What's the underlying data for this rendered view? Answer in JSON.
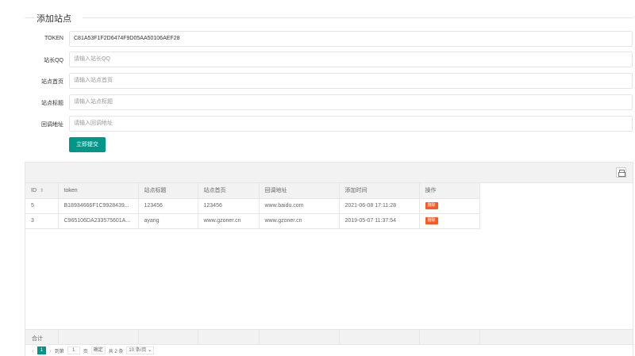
{
  "form": {
    "title": "添加站点",
    "fields": [
      {
        "label": "TOKEN",
        "value": "C81A53F1F2D6474F9D05AA50106AEF28",
        "placeholder": ""
      },
      {
        "label": "站长QQ",
        "value": "",
        "placeholder": "请输入站长QQ"
      },
      {
        "label": "站点首页",
        "value": "",
        "placeholder": "请输入站点首页"
      },
      {
        "label": "站点标题",
        "value": "",
        "placeholder": "请输入站点标题"
      },
      {
        "label": "回调地址",
        "value": "",
        "placeholder": "请输入回调地址"
      }
    ],
    "submit_label": "立即提交"
  },
  "table": {
    "print_icon": "print-icon",
    "headers": {
      "id": "ID",
      "token": "token",
      "title": "站点标题",
      "home": "站点首页",
      "callback": "回调地址",
      "time": "添加时间",
      "op": "操作"
    },
    "rows": [
      {
        "id": "5",
        "token": "B18934666F1C9928439...",
        "title": "123456",
        "home": "123456",
        "callback": "www.baidu.com",
        "time": "2021-06-08 17:11:28",
        "op": "删除"
      },
      {
        "id": "3",
        "token": "C965106DA233575601A...",
        "title": "ayang",
        "home": "www.gzoner.cn",
        "callback": "www.gzoner.cn",
        "time": "2019-05-07 11:37:54",
        "op": "删除"
      }
    ],
    "total_label": "合计",
    "colors": {
      "accent": "#009688",
      "danger": "#ff5722"
    }
  },
  "pager": {
    "current": "1",
    "goto_prefix": "到第",
    "goto_value": "1",
    "goto_suffix": "页",
    "confirm": "确定",
    "total": "共 2 条",
    "page_size": "10 条/页"
  }
}
